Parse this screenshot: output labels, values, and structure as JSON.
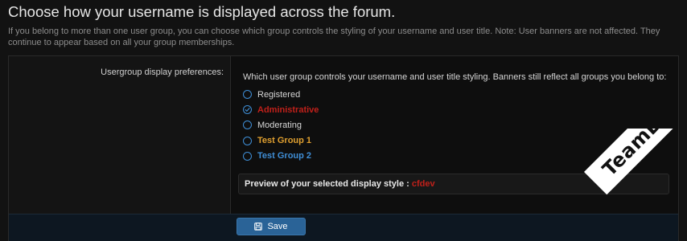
{
  "page": {
    "title": "Choose how your username is displayed across the forum.",
    "description": "If you belong to more than one user group, you can choose which group controls the styling of your username and user title. Note: User banners are not affected. They continue to appear based on all your group memberships."
  },
  "form": {
    "row_label": "Usergroup display preferences:",
    "explain": "Which user group controls your username and user title styling. Banners still reflect all groups you belong to:",
    "options": [
      {
        "label": "Registered",
        "color": "#d6d6d6",
        "bold": false,
        "selected": false
      },
      {
        "label": "Administrative",
        "color": "#c0201a",
        "bold": true,
        "selected": true
      },
      {
        "label": "Moderating",
        "color": "#d6d6d6",
        "bold": false,
        "selected": false
      },
      {
        "label": "Test Group 1",
        "color": "#e0a030",
        "bold": true,
        "selected": false
      },
      {
        "label": "Test Group 2",
        "color": "#3f8ed6",
        "bold": true,
        "selected": false
      }
    ],
    "preview_label": "Preview of your selected display style :",
    "preview_user": "cfdev"
  },
  "footer": {
    "save_label": "Save"
  },
  "watermark": {
    "text": "TeamDGT.org"
  },
  "colors": {
    "accent": "#2a6397",
    "radio": "#3f8ed6",
    "admin": "#c0201a"
  }
}
